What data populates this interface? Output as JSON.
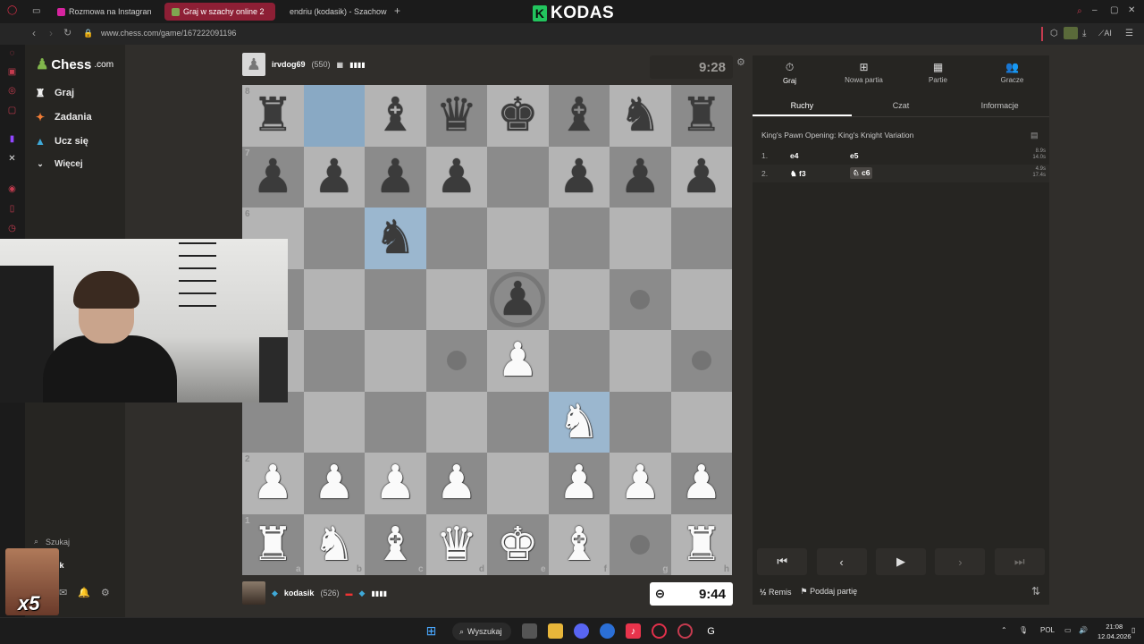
{
  "browser": {
    "tabs": [
      {
        "label": "Rozmowa na Instagran",
        "active": false
      },
      {
        "label": "Graj w szachy online 2",
        "active": true
      },
      {
        "label": "endriu (kodasik) - Szachow",
        "active": false
      }
    ],
    "new_tab": "+",
    "url": "www.chess.com/game/167222091196",
    "brand": "KODAS",
    "brand_mark": "K",
    "ai_label": "AI"
  },
  "nav": {
    "logo": "Chess",
    "logo_suffix": ".com",
    "items": [
      {
        "label": "Graj",
        "icon": "play-icon"
      },
      {
        "label": "Zadania",
        "icon": "puzzle-icon"
      },
      {
        "label": "Ucz się",
        "icon": "learn-icon"
      },
      {
        "label": "Więcej",
        "icon": "chevron-down-icon"
      }
    ],
    "search": "Szukaj",
    "user": "kodasik"
  },
  "top_player": {
    "name": "irvdog69",
    "rating": "(550)",
    "clock": "9:28"
  },
  "bottom_player": {
    "name": "kodasik",
    "rating": "(526)",
    "clock": "9:44"
  },
  "board": {
    "ranks": [
      "8",
      "7",
      "6",
      "5",
      "4",
      "3",
      "2",
      "1"
    ],
    "files": [
      "a",
      "b",
      "c",
      "d",
      "e",
      "f",
      "g",
      "h"
    ],
    "rows": [
      [
        "br",
        "  ",
        "bb",
        "bq",
        "bk",
        "bb",
        "bn",
        "br"
      ],
      [
        "bp",
        "bp",
        "bp",
        "bp",
        "  ",
        "bp",
        "bp",
        "bp"
      ],
      [
        "  ",
        "  ",
        "bn",
        "  ",
        "  ",
        "  ",
        "  ",
        "  "
      ],
      [
        "  ",
        "  ",
        "  ",
        "  ",
        "bp",
        "  ",
        "  ",
        "  "
      ],
      [
        "  ",
        "  ",
        "  ",
        "  ",
        "wp",
        "  ",
        "  ",
        "  "
      ],
      [
        "  ",
        "  ",
        "  ",
        "  ",
        "  ",
        "wn",
        "  ",
        "  "
      ],
      [
        "wp",
        "wp",
        "wp",
        "wp",
        "  ",
        "wp",
        "wp",
        "wp"
      ],
      [
        "wr",
        "wn",
        "wb",
        "wq",
        "wk",
        "wb",
        "  ",
        "wr"
      ]
    ],
    "highlights": [
      "b8",
      "c6",
      "f3"
    ],
    "move_dots": [
      "g5",
      "d4",
      "h4",
      "g1"
    ],
    "capture_ring": [
      "e5"
    ]
  },
  "panel": {
    "tabs": [
      {
        "label": "Graj",
        "icon": "stopwatch-icon"
      },
      {
        "label": "Nowa partia",
        "icon": "plus-icon"
      },
      {
        "label": "Partie",
        "icon": "board-icon"
      },
      {
        "label": "Gracze",
        "icon": "players-icon"
      }
    ],
    "subtabs": [
      "Ruchy",
      "Czat",
      "Informacje"
    ],
    "opening": "King's Pawn Opening: King's Knight Variation",
    "moves": [
      {
        "num": "1.",
        "white": "e4",
        "black": "e5",
        "t1": "8.9s",
        "t2": "14.0s"
      },
      {
        "num": "2.",
        "white": "f3",
        "black": "c6",
        "t1": "4.9s",
        "t2": "17.4s"
      }
    ],
    "draw_label": "Remis",
    "resign_label": "Poddaj partię"
  },
  "taskbar": {
    "search": "Wyszukaj",
    "lang": "POL",
    "time": "21:08",
    "date": "12.04.2026"
  },
  "overlay": {
    "multiplier": "x5"
  }
}
